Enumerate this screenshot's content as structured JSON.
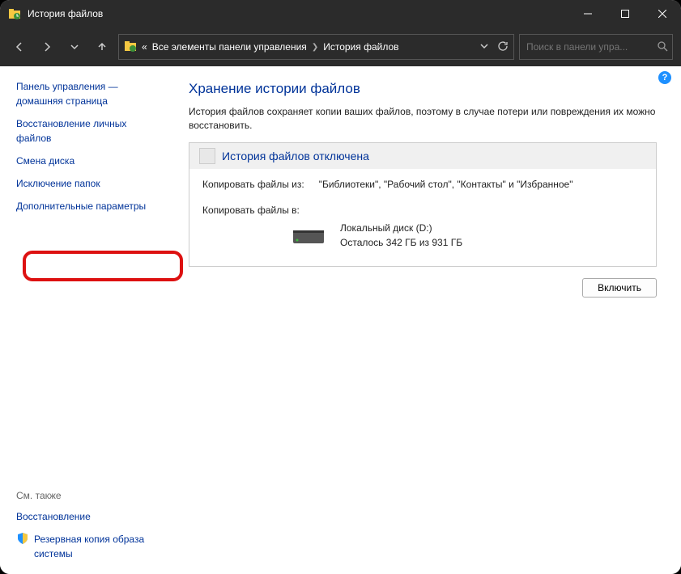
{
  "titlebar": {
    "title": "История файлов"
  },
  "breadcrumb": {
    "prefix": "«",
    "item1": "Все элементы панели управления",
    "item2": "История файлов"
  },
  "search": {
    "placeholder": "Поиск в панели упра..."
  },
  "sidebar": {
    "links": [
      "Панель управления — домашняя страница",
      "Восстановление личных файлов",
      "Смена диска",
      "Исключение папок",
      "Дополнительные параметры"
    ],
    "see_also": "См. также",
    "recovery": "Восстановление",
    "backup_image": "Резервная копия образа системы"
  },
  "main": {
    "heading": "Хранение истории файлов",
    "desc": "История файлов сохраняет копии ваших файлов, поэтому в случае потери или повреждения их можно восстановить.",
    "panel_title": "История файлов отключена",
    "copy_from_label": "Копировать файлы из:",
    "copy_from_value": "\"Библиотеки\", \"Рабочий стол\", \"Контакты\" и \"Избранное\"",
    "copy_to_label": "Копировать файлы в:",
    "drive_name": "Локальный диск (D:)",
    "drive_space": "Осталось 342 ГБ из 931 ГБ",
    "enable_button": "Включить"
  }
}
